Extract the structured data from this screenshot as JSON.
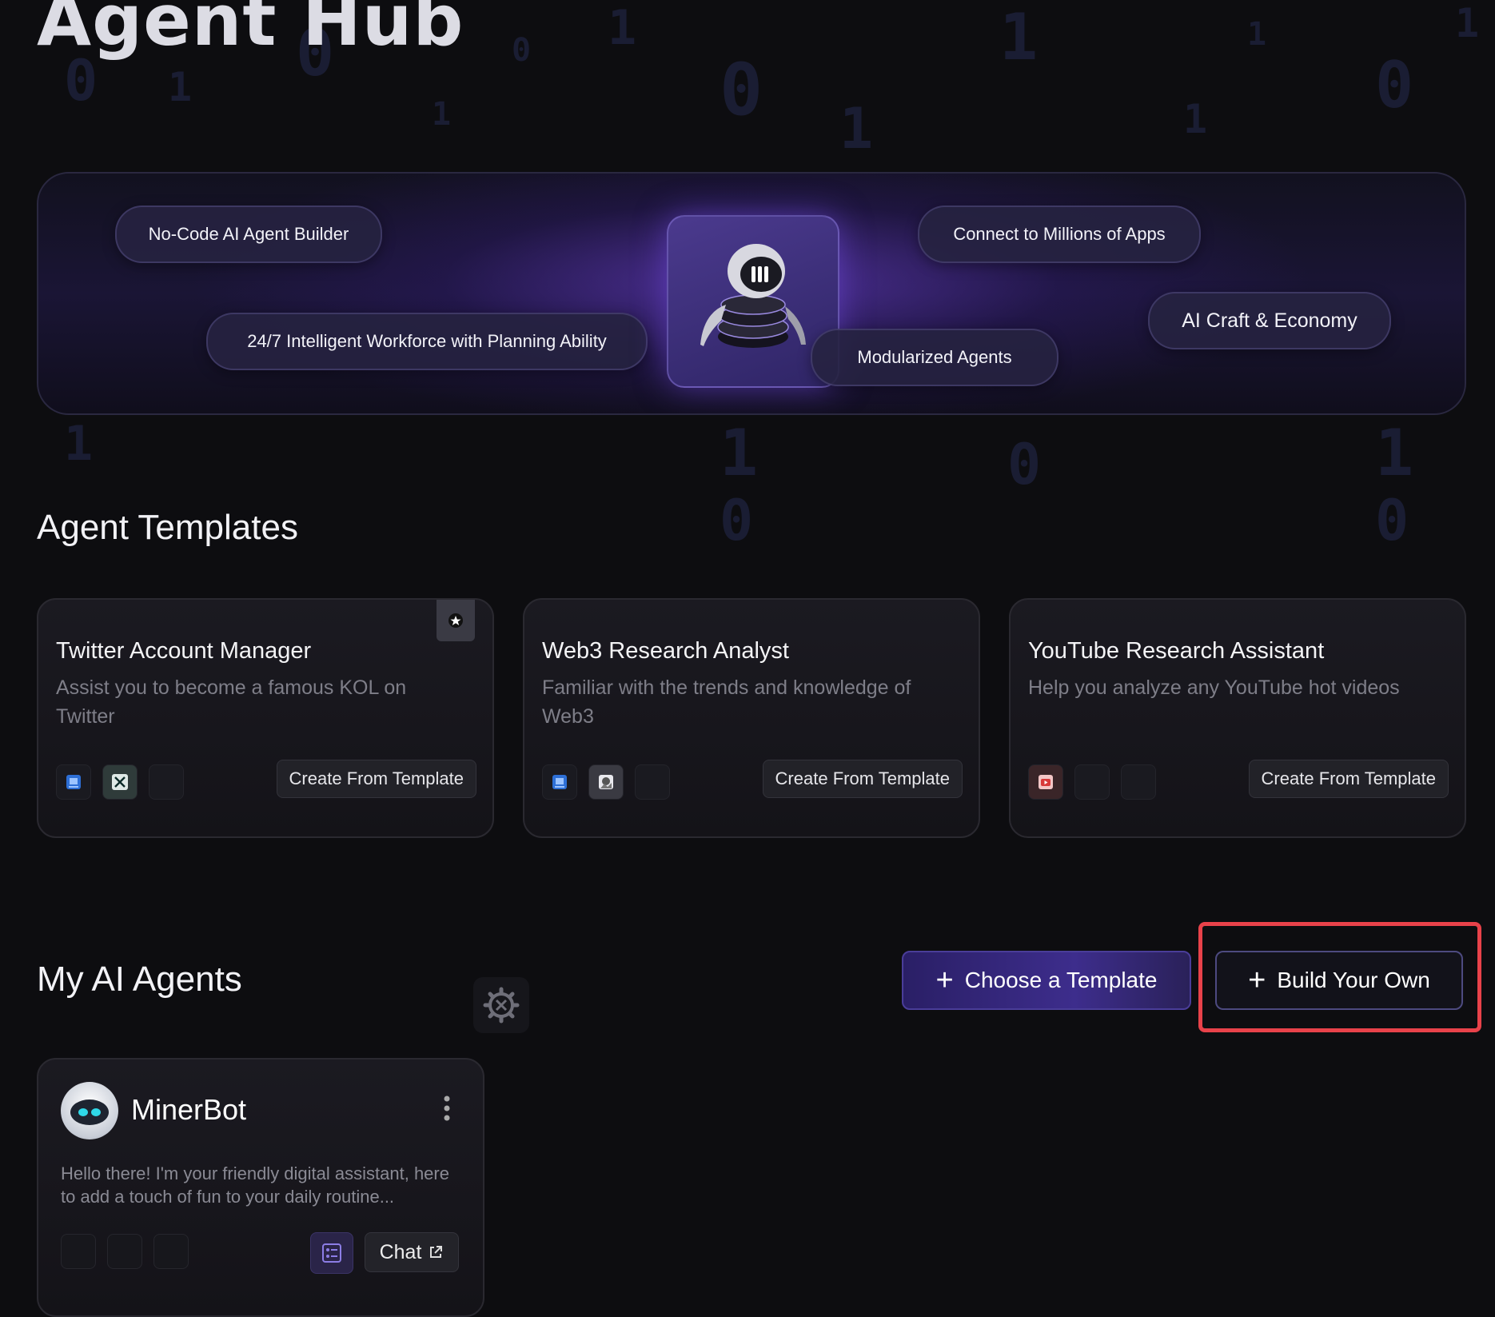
{
  "page": {
    "title": "Agent Hub"
  },
  "banner": {
    "pills": [
      "No-Code AI Agent Builder",
      "24/7 Intelligent Workforce with Planning Ability",
      "Connect to Millions of Apps",
      "Modularized Agents",
      "AI Craft & Economy"
    ]
  },
  "templates": {
    "heading": "Agent Templates",
    "cards": [
      {
        "title": "Twitter Account Manager",
        "description": "Assist you to become a famous KOL on Twitter",
        "button": "Create From Template",
        "icons": [
          "document-icon",
          "x-twitter-icon"
        ]
      },
      {
        "title": "Web3 Research Analyst",
        "description": "Familiar with the trends and knowledge of Web3",
        "button": "Create From Template",
        "icons": [
          "document-icon",
          "image-search-icon"
        ]
      },
      {
        "title": "YouTube Research Assistant",
        "description": "Help you analyze any YouTube hot videos",
        "button": "Create From Template",
        "icons": [
          "youtube-icon"
        ]
      }
    ]
  },
  "my_agents": {
    "heading": "My AI Agents",
    "choose_label": "Choose a Template",
    "build_label": "Build Your Own",
    "agent": {
      "name": "MinerBot",
      "description": "Hello there! I'm your friendly digital assistant, here to add a touch of fun to your daily routine...",
      "chat_label": "Chat"
    }
  },
  "colors": {
    "accent": "#3d2d8c",
    "highlight": "#e8424a",
    "background": "#0d0d10"
  }
}
